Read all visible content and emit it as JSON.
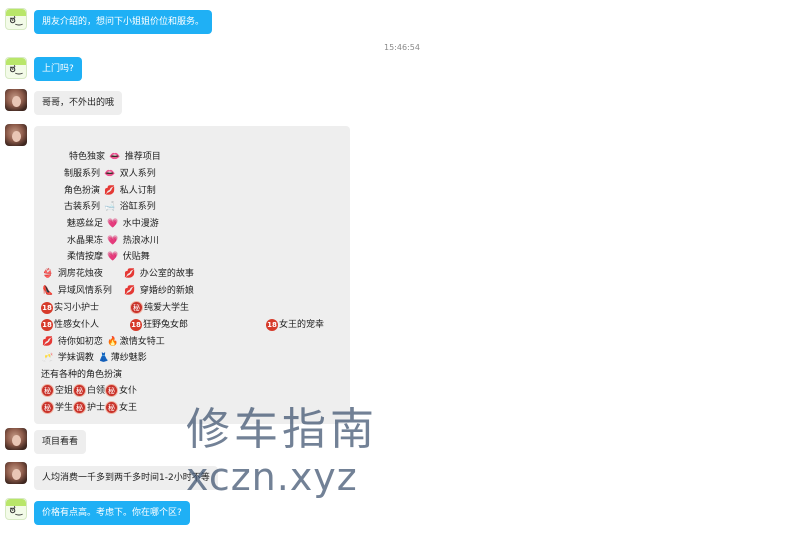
{
  "timestamp": "15:46:54",
  "messages": {
    "m1": "朋友介绍的，想问下小姐姐价位和服务。",
    "m2": "上门吗?",
    "m3": "哥哥，不外出的哦",
    "m5": "项目看看",
    "m6": "人均消费一千多到两千多时间1-2小时不等",
    "m7": "价格有点高。考虑下。你在哪个区?"
  },
  "menu": {
    "r1a": "特色独家",
    "r1b": "推荐项目",
    "r2a": "制服系列",
    "r2b": "双人系列",
    "r3a": "角色扮演",
    "r3b": "私人订制",
    "r4a": "古装系列",
    "r4b": "浴缸系列",
    "r5a": "魅惑丝足",
    "r5b": "水中漫游",
    "r6a": "水晶果冻",
    "r6b": "热浪冰川",
    "r7a": "柔情按摩",
    "r7b": "伏贴舞",
    "r8a": "洞房花烛夜",
    "r8b": "办公室的故事",
    "r9a": "异域风情系列",
    "r9b": "穿婚纱的新娘",
    "r10a": "实习小护士",
    "r10b": "纯爱大学生",
    "r11a": "性感女仆人",
    "r11b": "狂野兔女郎",
    "r11c": "女王的宠幸",
    "r12a": "待你如初恋",
    "r12b": "激情女特工",
    "r13a": "学妹调教",
    "r13b": "薄纱魅影",
    "r14": "还有各种的角色扮演",
    "r15a": "空姐",
    "r15b": "白领",
    "r15c": "女仆",
    "r16a": "学生",
    "r16b": "护士",
    "r16c": "女王",
    "badge18": "18",
    "badgemi": "秘"
  },
  "watermark": {
    "line1": "修车指南",
    "line2": "xczn.xyz"
  },
  "icons": [
    "lips-icon",
    "heart-icon",
    "bikini-icon",
    "high-heel-icon",
    "flower-icon",
    "dress-icon",
    "fire-icon",
    "bathtub-icon",
    "champagne-icon"
  ]
}
